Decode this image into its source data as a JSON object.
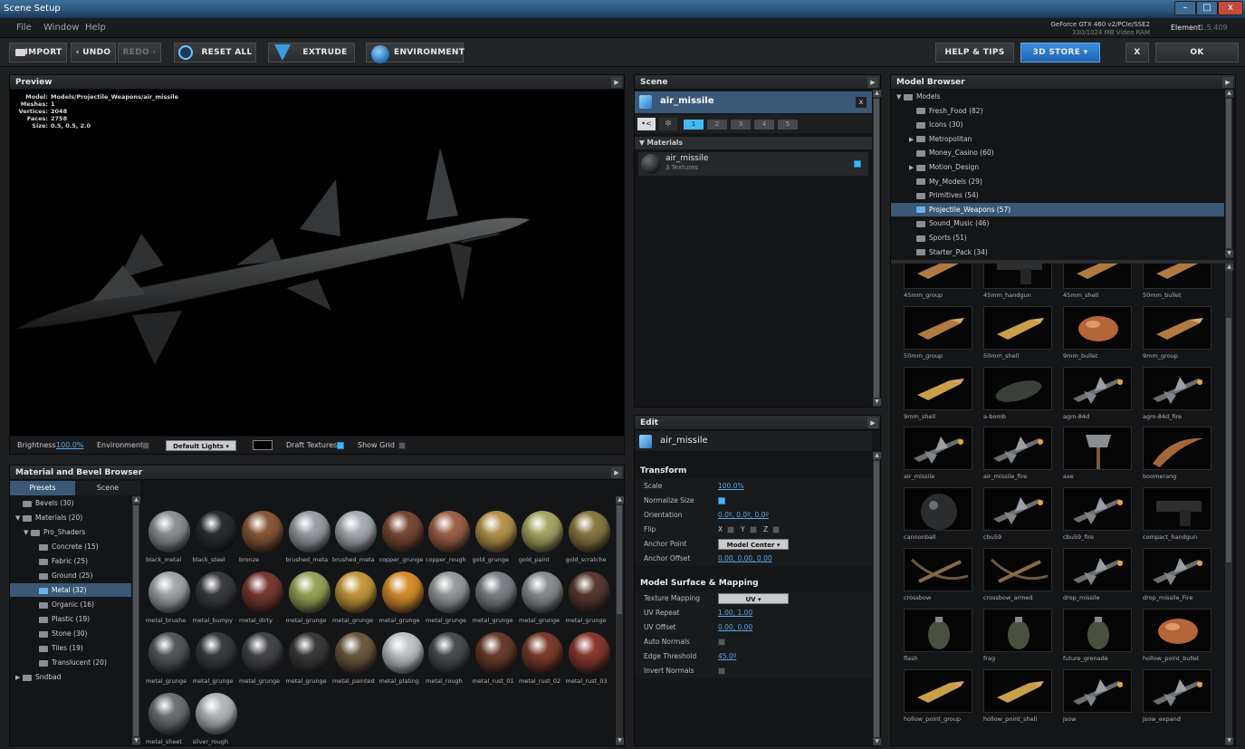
{
  "window": {
    "title": "Scene Setup",
    "controls": {
      "minimize": "–",
      "maximize": "□",
      "close": "x"
    }
  },
  "menu": {
    "items": [
      "File",
      "Window",
      "Help"
    ],
    "gpu_line1": "GeForce GTX 460 v2/PCIe/SSE2",
    "gpu_line2": "330/1024 MB Video RAM",
    "element_name": "Element",
    "element_version": "1.5.409"
  },
  "toolbar": {
    "import": "IMPORT",
    "undo": "UNDO",
    "redo": "REDO",
    "reset_all": "RESET ALL",
    "extrude": "EXTRUDE",
    "environment": "ENVIRONMENT",
    "help_tips": "HELP & TIPS",
    "store": "3D STORE",
    "close": "X",
    "ok": "OK"
  },
  "preview": {
    "title": "Preview",
    "info": {
      "model_label": "Model:",
      "model_value": "Models/Projectile_Weapons/air_missile",
      "meshes_label": "Meshes:",
      "meshes_value": "1",
      "vertices_label": "Vertices:",
      "vertices_value": "2048",
      "faces_label": "Faces:",
      "faces_value": "2758",
      "size_label": "Size:",
      "size_value": "0.5, 0.5, 2.0"
    },
    "controls": {
      "brightness_label": "Brightness",
      "brightness_value": "100.0%",
      "environment_label": "Environment",
      "environment_checked": false,
      "lights_option": "Default Lights",
      "draft_textures_label": "Draft Textures",
      "draft_textures_checked": true,
      "show_grid_label": "Show Grid",
      "show_grid_checked": false
    }
  },
  "material_browser": {
    "title": "Material and Bevel Browser",
    "tabs": [
      "Presets",
      "Scene"
    ],
    "active_tab": "Presets",
    "tree": [
      {
        "label": "Bevels (30)",
        "level": 0,
        "expander": "",
        "selected": false
      },
      {
        "label": "Materials (20)",
        "level": 0,
        "expander": "▼",
        "selected": false
      },
      {
        "label": "Pro_Shaders",
        "level": 1,
        "expander": "▼",
        "selected": false
      },
      {
        "label": "Concrete (15)",
        "level": 2,
        "expander": "",
        "selected": false
      },
      {
        "label": "Fabric (25)",
        "level": 2,
        "expander": "",
        "selected": false
      },
      {
        "label": "Ground (25)",
        "level": 2,
        "expander": "",
        "selected": false
      },
      {
        "label": "Metal (32)",
        "level": 2,
        "expander": "",
        "selected": true
      },
      {
        "label": "Organic (16)",
        "level": 2,
        "expander": "",
        "selected": false
      },
      {
        "label": "Plastic (19)",
        "level": 2,
        "expander": "",
        "selected": false
      },
      {
        "label": "Stone (30)",
        "level": 2,
        "expander": "",
        "selected": false
      },
      {
        "label": "Tiles (19)",
        "level": 2,
        "expander": "",
        "selected": false
      },
      {
        "label": "Translucent (20)",
        "level": 2,
        "expander": "",
        "selected": false
      },
      {
        "label": "Sndbad",
        "level": 0,
        "expander": "▶",
        "selected": false
      }
    ],
    "materials": [
      {
        "label": "black_metal",
        "color": "#8d9296"
      },
      {
        "label": "black_steel",
        "color": "#2a2d31"
      },
      {
        "label": "bronze",
        "color": "#8a5a3a"
      },
      {
        "label": "brushed_meta",
        "color": "#9aa0a5"
      },
      {
        "label": "brushed_meta",
        "color": "#a8aeb3"
      },
      {
        "label": "copper_grunge",
        "color": "#7a4a36"
      },
      {
        "label": "copper_rough",
        "color": "#a0634a"
      },
      {
        "label": "gold_grunge",
        "color": "#b8954f"
      },
      {
        "label": "gold_paint",
        "color": "#a8a866"
      },
      {
        "label": "gold_scratche",
        "color": "#8c7a45"
      },
      {
        "label": "metal_brushe",
        "color": "#a2a7ab"
      },
      {
        "label": "metal_bumpy",
        "color": "#3a3c3f"
      },
      {
        "label": "metal_dirty",
        "color": "#7a3a33"
      },
      {
        "label": "metal_grunge",
        "color": "#9aa65a"
      },
      {
        "label": "metal_grunge",
        "color": "#c59a3c"
      },
      {
        "label": "metal_grunge",
        "color": "#d88f2e"
      },
      {
        "label": "metal_grunge",
        "color": "#9a9d9f"
      },
      {
        "label": "metal_grunge",
        "color": "#7e8388"
      },
      {
        "label": "metal_grunge",
        "color": "#8c8f92"
      },
      {
        "label": "metal_grunge",
        "color": "#5a3a33"
      },
      {
        "label": "metal_grunge",
        "color": "#55595e"
      },
      {
        "label": "metal_grunge",
        "color": "#3a3d40"
      },
      {
        "label": "metal_grunge",
        "color": "#45474a"
      },
      {
        "label": "metal_grunge",
        "color": "#3b3b3b"
      },
      {
        "label": "metal_painted",
        "color": "#6e5a40"
      },
      {
        "label": "metal_plating",
        "color": "#c2c6ca"
      },
      {
        "label": "metal_rough",
        "color": "#4a4e52"
      },
      {
        "label": "metal_rust_01",
        "color": "#6a3c2e"
      },
      {
        "label": "metal_rust_02",
        "color": "#7c3d2e"
      },
      {
        "label": "metal_rust_03",
        "color": "#8a3a30"
      },
      {
        "label": "metal_sheet",
        "color": "#6e7378"
      },
      {
        "label": "silver_rough",
        "color": "#b4b9be"
      }
    ]
  },
  "scene": {
    "title": "Scene",
    "object_name": "air_missile",
    "close": "x",
    "group_tabs": [
      "1",
      "2",
      "3",
      "4",
      "5"
    ],
    "materials_header": "Materials",
    "material": {
      "name": "air_missile",
      "textures": "3 Textures"
    }
  },
  "edit": {
    "title": "Edit",
    "object_name": "air_missile",
    "transform_header": "Transform",
    "transform": {
      "scale_label": "Scale",
      "scale_value": "100.0%",
      "normalize_label": "Normalize Size",
      "normalize_checked": true,
      "orientation_label": "Orientation",
      "orientation_value": "0.0º, 0.0º, 0.0º",
      "flip_label": "Flip",
      "flip_x": "X",
      "flip_y": "Y",
      "flip_z": "Z",
      "anchor_point_label": "Anchor Point",
      "anchor_point_value": "Model Center",
      "anchor_offset_label": "Anchor Offset",
      "anchor_offset_value": "0.00, 0.00, 0.00"
    },
    "surface_header": "Model Surface & Mapping",
    "surface": {
      "texture_mapping_label": "Texture Mapping",
      "texture_mapping_value": "UV",
      "uv_repeat_label": "UV Repeat",
      "uv_repeat_value": "1.00, 1.00",
      "uv_offset_label": "UV Offset",
      "uv_offset_value": "0.00, 0.00",
      "auto_normals_label": "Auto Normals",
      "edge_threshold_label": "Edge Threshold",
      "edge_threshold_value": "45.0º",
      "invert_normals_label": "Invert Normals"
    }
  },
  "model_browser": {
    "title": "Model Browser",
    "tree": [
      {
        "label": "Models",
        "level": 0,
        "expander": "▼",
        "selected": false
      },
      {
        "label": "Fresh_Food (82)",
        "level": 1,
        "expander": "",
        "selected": false
      },
      {
        "label": "Icons (30)",
        "level": 1,
        "expander": "",
        "selected": false
      },
      {
        "label": "Metropolitan",
        "level": 1,
        "expander": "▶",
        "selected": false
      },
      {
        "label": "Money_Casino (60)",
        "level": 1,
        "expander": "",
        "selected": false
      },
      {
        "label": "Motion_Design",
        "level": 1,
        "expander": "▶",
        "selected": false
      },
      {
        "label": "My_Models (29)",
        "level": 1,
        "expander": "",
        "selected": false
      },
      {
        "label": "Primitives (54)",
        "level": 1,
        "expander": "",
        "selected": false
      },
      {
        "label": "Projectile_Weapons (57)",
        "level": 1,
        "expander": "",
        "selected": true
      },
      {
        "label": "Sound_Music (46)",
        "level": 1,
        "expander": "",
        "selected": false
      },
      {
        "label": "Sports (51)",
        "level": 1,
        "expander": "",
        "selected": false
      },
      {
        "label": "Starter_Pack (34)",
        "level": 1,
        "expander": "",
        "selected": false
      }
    ],
    "models": [
      {
        "label": "45mm_group",
        "kind": "bullet"
      },
      {
        "label": "45mm_handgun",
        "kind": "gun"
      },
      {
        "label": "45mm_shell",
        "kind": "bullet"
      },
      {
        "label": "50mm_bullet",
        "kind": "bullet"
      },
      {
        "label": "50mm_group",
        "kind": "bullet"
      },
      {
        "label": "50mm_shell",
        "kind": "shell"
      },
      {
        "label": "9mm_bullet",
        "kind": "round"
      },
      {
        "label": "9mm_group",
        "kind": "bullet"
      },
      {
        "label": "9mm_shell",
        "kind": "shell"
      },
      {
        "label": "a-bomb",
        "kind": "bomb"
      },
      {
        "label": "agm-84d",
        "kind": "missile"
      },
      {
        "label": "agm-84d_fire",
        "kind": "missile"
      },
      {
        "label": "air_missile",
        "kind": "missile"
      },
      {
        "label": "air_missile_fire",
        "kind": "missile"
      },
      {
        "label": "axe",
        "kind": "axe"
      },
      {
        "label": "boomerang",
        "kind": "boomerang"
      },
      {
        "label": "cannonball",
        "kind": "ball"
      },
      {
        "label": "cbu59",
        "kind": "missile"
      },
      {
        "label": "cbu59_fire",
        "kind": "missile"
      },
      {
        "label": "compact_handgun",
        "kind": "gun"
      },
      {
        "label": "crossbow",
        "kind": "crossbow"
      },
      {
        "label": "crossbow_armed",
        "kind": "crossbow"
      },
      {
        "label": "drop_missile",
        "kind": "missile"
      },
      {
        "label": "drop_missile_Fire",
        "kind": "missile"
      },
      {
        "label": "flash",
        "kind": "grenade"
      },
      {
        "label": "frag",
        "kind": "grenade"
      },
      {
        "label": "future_grenade",
        "kind": "grenade"
      },
      {
        "label": "hollow_point_bullet",
        "kind": "round"
      },
      {
        "label": "hollow_point_group",
        "kind": "shell"
      },
      {
        "label": "hollow_point_shell",
        "kind": "shell"
      },
      {
        "label": "jsow",
        "kind": "missile"
      },
      {
        "label": "jsow_expand",
        "kind": "missile"
      }
    ]
  },
  "colors": {
    "accent": "#44b7f2",
    "selection": "#3a5877",
    "panel": "#141516",
    "store_button": "#2a78c8"
  },
  "icons": {
    "import": "folder-icon",
    "reset": "reset-icon",
    "extrude": "extrude-icon",
    "environment": "globe-icon"
  }
}
